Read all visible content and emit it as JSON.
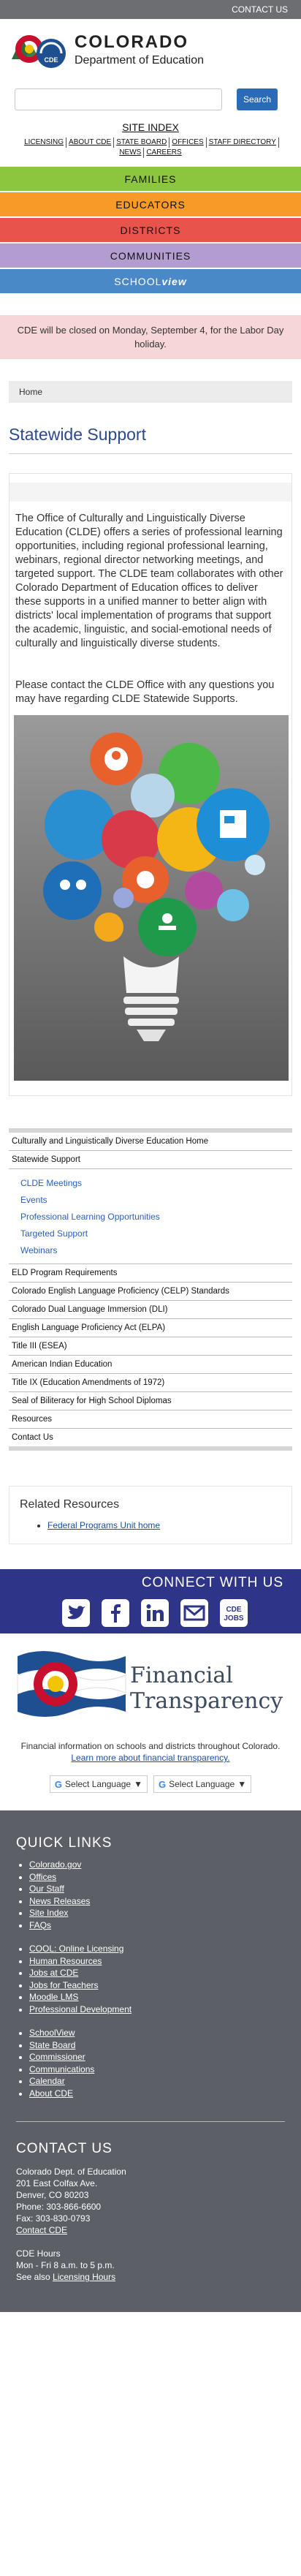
{
  "topbar": {
    "contact_link": "CONTACT US"
  },
  "brand": {
    "title": "COLORADO",
    "subtitle": "Department of Education",
    "logo_badge": "CDE"
  },
  "search": {
    "placeholder": "",
    "button_label": "Search"
  },
  "site_index": "SITE INDEX",
  "util_links": [
    "LICENSING",
    "ABOUT CDE",
    "STATE BOARD",
    "OFFICES",
    "STAFF DIRECTORY",
    "NEWS",
    "CAREERS"
  ],
  "nav": {
    "families": "FAMILIES",
    "educators": "EDUCATORS",
    "districts": "DISTRICTS",
    "communities": "COMMUNITIES",
    "schoolview_a": "SCHOOL",
    "schoolview_b": "view"
  },
  "alert": "CDE will be closed on Monday, September 4, for the Labor Day holiday.",
  "breadcrumb": "Home",
  "page_title": "Statewide Support",
  "body": {
    "p1": "The Office of Culturally and Linguistically Diverse Education (CLDE) offers a series of professional learning opportunities, including regional professional learning, webinars, regional director networking meetings, and targeted support. The CLDE team collaborates with other Colorado Department of Education offices to deliver these supports in a unified manner to better align with districts' local implementation of programs that support the academic, linguistic, and social-emotional needs of culturally and linguistically diverse students.",
    "p2": "Please contact the CLDE Office with any questions you may have regarding CLDE Statewide Supports."
  },
  "sidenav": {
    "home": "Culturally and Linguistically Diverse Education Home",
    "statewide": "Statewide Support",
    "sub": [
      "CLDE Meetings",
      "Events",
      "Professional Learning Opportunities",
      "Targeted Support",
      "Webinars"
    ],
    "items": [
      "ELD Program Requirements",
      "Colorado English Language Proficiency (CELP) Standards",
      "Colorado Dual Language Immersion (DLI)",
      "English Language Proficiency Act (ELPA)",
      "Title III (ESEA)",
      "American Indian Education",
      "Title IX (Education Amendments of 1972)",
      "Seal of Biliteracy for High School Diplomas",
      "Resources",
      "Contact Us"
    ]
  },
  "related": {
    "title": "Related Resources",
    "link": "Federal Programs Unit home"
  },
  "connect": {
    "title": "CONNECT WITH US",
    "icons": [
      "twitter-icon",
      "facebook-icon",
      "linkedin-icon",
      "email-icon",
      "cde-jobs-icon"
    ],
    "jobs_a": "CDE",
    "jobs_b": "JOBS"
  },
  "transparency": {
    "title_a": "Financial",
    "title_b": "Transparency",
    "desc": "Financial information on schools and districts throughout Colorado.",
    "link": "Learn more about financial transparency.",
    "lang_label": "Select Language"
  },
  "quick_links": {
    "title": "QUICK LINKS",
    "group1": [
      "Colorado.gov",
      "Offices",
      "Our Staff",
      "News Releases",
      "Site Index",
      "FAQs"
    ],
    "group2": [
      "COOL: Online Licensing",
      "Human Resources",
      "Jobs at CDE",
      "Jobs for Teachers",
      "Moodle LMS",
      "Professional Development"
    ],
    "group3": [
      "SchoolView",
      "State Board",
      "Commissioner",
      "Communications",
      "Calendar",
      "About CDE"
    ]
  },
  "contact_us": {
    "title": "CONTACT US",
    "lines": [
      "Colorado Dept. of Education",
      "201 East Colfax Ave.",
      "Denver, CO 80203",
      "Phone: 303-866-6600",
      "Fax: 303-830-0793"
    ],
    "link": "Contact CDE",
    "hours_title": "CDE Hours",
    "hours": "Mon - Fri 8 a.m. to 5 p.m.",
    "hours_more": "See also",
    "hours_link": "Licensing Hours"
  },
  "colors": {
    "families": "#8cc63f",
    "educators": "#f79a28",
    "districts": "#e8534b",
    "communities": "#b39dd0",
    "schoolview": "#4a89c8",
    "connect": "#2e3588",
    "footer": "#5c6066"
  }
}
